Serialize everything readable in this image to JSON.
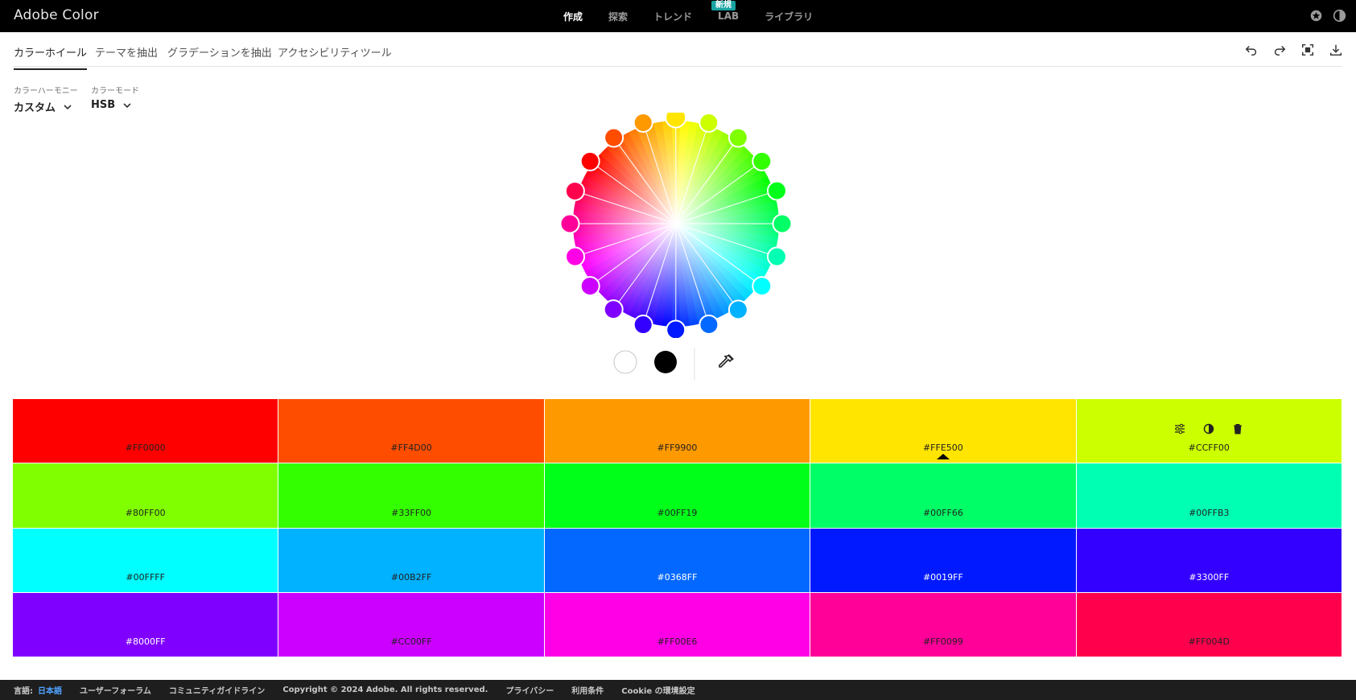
{
  "app": {
    "title": "Adobe Color"
  },
  "nav": {
    "items": [
      {
        "label": "作成"
      },
      {
        "label": "探索"
      },
      {
        "label": "トレンド"
      },
      {
        "label": "LAB",
        "badge": "新規"
      },
      {
        "label": "ライブラリ"
      }
    ]
  },
  "tabs": [
    {
      "label": "カラーホイール"
    },
    {
      "label": "テーマを抽出"
    },
    {
      "label": "グラデーションを抽出"
    },
    {
      "label": "アクセシビリティツール"
    }
  ],
  "controls": {
    "harmony": {
      "label": "カラーハーモニー",
      "value": "カスタム"
    },
    "mode": {
      "label": "カラーモード",
      "value": "HSB"
    }
  },
  "swatches": [
    {
      "hex": "#FF0000",
      "color": "#FF0000",
      "text_color": "#222222"
    },
    {
      "hex": "#FF4D00",
      "color": "#FF4D00",
      "text_color": "#222222"
    },
    {
      "hex": "#FF9900",
      "color": "#FF9900",
      "text_color": "#222222"
    },
    {
      "hex": "#FFE500",
      "color": "#FFE500",
      "text_color": "#222222",
      "selected": true
    },
    {
      "hex": "#CCFF00",
      "color": "#CCFF00",
      "text_color": "#222222",
      "hovered": true
    },
    {
      "hex": "#80FF00",
      "color": "#80FF00",
      "text_color": "#222222"
    },
    {
      "hex": "#33FF00",
      "color": "#33FF00",
      "text_color": "#222222"
    },
    {
      "hex": "#00FF19",
      "color": "#00FF19",
      "text_color": "#222222"
    },
    {
      "hex": "#00FF66",
      "color": "#00FF66",
      "text_color": "#222222"
    },
    {
      "hex": "#00FFB3",
      "color": "#00FFB3",
      "text_color": "#222222"
    },
    {
      "hex": "#00FFFF",
      "color": "#00FFFF",
      "text_color": "#222222"
    },
    {
      "hex": "#00B2FF",
      "color": "#00B2FF",
      "text_color": "#222222"
    },
    {
      "hex": "#0368FF",
      "color": "#0368FF",
      "text_color": "#FFFFFF"
    },
    {
      "hex": "#0019FF",
      "color": "#0019FF",
      "text_color": "#FFFFFF"
    },
    {
      "hex": "#3300FF",
      "color": "#3300FF",
      "text_color": "#FFFFFF"
    },
    {
      "hex": "#8000FF",
      "color": "#8000FF",
      "text_color": "#FFFFFF"
    },
    {
      "hex": "#CC00FF",
      "color": "#CC00FF",
      "text_color": "#222222"
    },
    {
      "hex": "#FF00E6",
      "color": "#FF00E6",
      "text_color": "#222222"
    },
    {
      "hex": "#FF0099",
      "color": "#FF0099",
      "text_color": "#222222"
    },
    {
      "hex": "#FF004D",
      "color": "#FF004D",
      "text_color": "#222222"
    }
  ],
  "footer": {
    "language_label": "言語:",
    "language_value": "日本語",
    "links": [
      {
        "label": "ユーザーフォーラム"
      },
      {
        "label": "コミュニティガイドライン"
      },
      {
        "label": "Copyright © 2024 Adobe. All rights reserved."
      },
      {
        "label": "プライバシー"
      },
      {
        "label": "利用条件"
      },
      {
        "label": "Cookie の環境設定"
      }
    ]
  }
}
